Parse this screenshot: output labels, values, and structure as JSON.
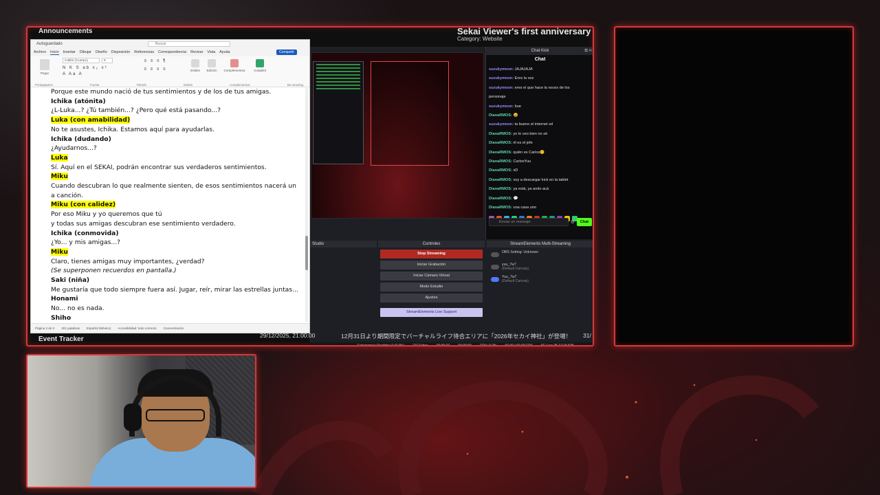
{
  "header": {
    "announcements": "Announcements",
    "sekai_title": "Sekai Viewer's first anniversary",
    "category": "Category: Website"
  },
  "word": {
    "autosave": "Autoguardado",
    "search_placeholder": "Buscar",
    "menu": [
      "Archivo",
      "Inicio",
      "Insertar",
      "Dibujar",
      "Diseño",
      "Disposición",
      "Referencias",
      "Correspondencia",
      "Revisar",
      "Vista",
      "Ayuda"
    ],
    "share_label": "Compartir",
    "ribbon": {
      "paste": "Pegar",
      "font_name": "Calibri (Cuerpo)",
      "font_size": "8",
      "styles": "Estilos",
      "editing": "Edición",
      "addins": "Complementos",
      "addin2": "Autopilot",
      "group_clipboard": "Portapapeles",
      "group_font": "Fuente",
      "group_paragraph": "Párrafo",
      "group_styles": "Estilos",
      "group_addins": "Complementos",
      "group_last": "Be amazing"
    },
    "lines": [
      {
        "text": "Porque este mundo nació de tus sentimientos y de los de tus amigas.",
        "style": ""
      },
      {
        "text": "Ichika (atónita)",
        "style": "b"
      },
      {
        "text": "¿L-Luka...? ¿Tú también...? ¿Pero qué está pasando...?",
        "style": ""
      },
      {
        "text": "Luka (con amabilidad)",
        "style": "hl"
      },
      {
        "text": "No te asustes, Ichika. Estamos aquí para ayudarlas.",
        "style": ""
      },
      {
        "text": "Ichika (dudando)",
        "style": "b"
      },
      {
        "text": "¿Ayudarnos...?",
        "style": ""
      },
      {
        "text": "Luka",
        "style": "hl"
      },
      {
        "text": "Sí. Aquí en el SEKAI, podrán encontrar sus verdaderos sentimientos.",
        "style": ""
      },
      {
        "text": "Miku",
        "style": "hl"
      },
      {
        "text": "Cuando descubran lo que realmente sienten, de esos sentimientos nacerá un",
        "style": ""
      },
      {
        "text": "a canción.",
        "style": ""
      },
      {
        "text": "Miku (con calidez)",
        "style": "hl"
      },
      {
        "text": "Por eso Miku y yo queremos que tú",
        "style": ""
      },
      {
        "text": "y todas sus amigas descubran ese sentimiento verdadero.",
        "style": ""
      },
      {
        "text": "Ichika (conmovida)",
        "style": "b"
      },
      {
        "text": "¿Yo... y mis amigas...?",
        "style": ""
      },
      {
        "text": "Miku",
        "style": "hl"
      },
      {
        "text": "Claro, tienes amigas muy importantes, ¿verdad?",
        "style": ""
      },
      {
        "text": "(Se superponen recuerdos en pantalla.)",
        "style": "i"
      },
      {
        "text": "Saki (niña)",
        "style": "b"
      },
      {
        "text": "Me gustaría que todo siempre fuera así. Jugar, reír, mirar las estrellas juntas...",
        "style": ""
      },
      {
        "text": "Honami",
        "style": "b"
      },
      {
        "text": "No... no es nada.",
        "style": ""
      },
      {
        "text": "Shiho",
        "style": "b"
      }
    ],
    "status": [
      "Página 2 de 2",
      "201 palabras",
      "Español (México)",
      "Accesibilidad: todo correcto",
      "Concentración"
    ]
  },
  "chat": {
    "window_title": "Chat Kick",
    "title": "Chat",
    "messages": [
      {
        "user": "suzukymoon:",
        "text": "JAJAJAJA",
        "color": "u1"
      },
      {
        "user": "suzukymoon:",
        "text": "Eres la voz",
        "color": "u1"
      },
      {
        "user": "suzukymoon:",
        "text": "eres el que hace la voces de los",
        "color": "u1"
      },
      {
        "user": "",
        "text": "personaje",
        "color": "u1"
      },
      {
        "user": "suzukymoon:",
        "text": "bue",
        "color": "u1"
      },
      {
        "user": "DianaRMOS:",
        "text": "😄",
        "color": "u2"
      },
      {
        "user": "suzukymoon:",
        "text": "ta bueno el internet xd",
        "color": "u1"
      },
      {
        "user": "DianaRMOS:",
        "text": "yo lo veo bien no sé",
        "color": "u2"
      },
      {
        "user": "DianaRMOS:",
        "text": "él es el jefe",
        "color": "u2"
      },
      {
        "user": "DianaRMOS:",
        "text": "quién es Carlos😊",
        "color": "u2"
      },
      {
        "user": "DianaRMOS:",
        "text": "CarlosYuu",
        "color": "u2"
      },
      {
        "user": "DianaRMOS:",
        "text": "xD",
        "color": "u2"
      },
      {
        "user": "DianaRMOS:",
        "text": "voy a descargar kick en la tablet",
        "color": "u2"
      },
      {
        "user": "DianaRMOS:",
        "text": "ya está, ya ando acá",
        "color": "u2"
      },
      {
        "user": "DianaRMOS:",
        "text": "💬",
        "color": "u2"
      },
      {
        "user": "DianaRMOS:",
        "text": "una casa uno",
        "color": "u2"
      }
    ],
    "input_placeholder": "Enviar un mensaje",
    "send_label": "Chat",
    "emote_colors": [
      "#9b59b6",
      "#e74c3c",
      "#3fb0e0",
      "#2ecc71",
      "#2b7bd6",
      "#e67e22",
      "#c0392b",
      "#27ae60",
      "#16a085",
      "#8e44ad",
      "#f1c40f",
      "#2ecc71"
    ]
  },
  "obs": {
    "studio_label": "Studio",
    "controls_title": "Controles",
    "controls": [
      "Stop Streaming",
      "Iniciar Grabación",
      "Iniciar Cámara Virtual",
      "Modo Estudio",
      "Ajustes",
      "StreamElements Live Support"
    ],
    "multistream_title": "StreamElements Multi-Streaming",
    "ms_rows": [
      {
        "name": "OBS Setting: Unknown",
        "sub": ""
      },
      {
        "name": "yuu_7w7",
        "sub": "(Default Canvas)"
      },
      {
        "name": "Yuu_7w7",
        "sub": "(Default Canvas)"
      }
    ],
    "status": [
      "Fotogramas Perdidos 0 (0.0%)",
      "7112 kbps",
      "00:36:07",
      "00:00:00",
      "CPU: 9.2%",
      "60.00 / 60.00 FPS",
      "SE.Live 25.12.15.535"
    ]
  },
  "ticker": {
    "event_tracker": "Event Tracker",
    "date": "29/12/2025, 21:00:00",
    "text": "12月31日より期間限定でバーチャルライフ待合エリアに「2026年セカイ神社」が登場！",
    "end": "31/"
  },
  "colors": {
    "frame_border": "#d33a3a",
    "highlight": "#ffff00",
    "kick_green": "#53fc18",
    "stop_red": "#b02a22"
  }
}
